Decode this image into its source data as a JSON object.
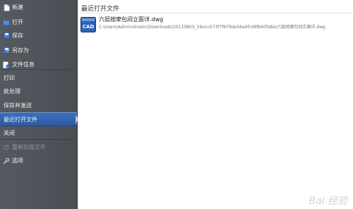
{
  "sidebar": {
    "items": [
      {
        "label": "新建",
        "icon": "new-file-icon"
      },
      {
        "label": "打开",
        "icon": "open-folder-icon"
      },
      {
        "label": "保存",
        "icon": "save-icon"
      },
      {
        "label": "另存为",
        "icon": "save-as-icon"
      },
      {
        "label": "文件信息",
        "icon": "file-info-icon"
      },
      {
        "label": "打印"
      },
      {
        "label": "批处理"
      },
      {
        "label": "保存并发送"
      },
      {
        "label": "最近打开文件"
      },
      {
        "label": "关闭"
      },
      {
        "label": "重新加载文件",
        "icon": "reload-icon"
      },
      {
        "label": "选项",
        "icon": "wrench-icon"
      }
    ]
  },
  "main": {
    "title": "最近打开文件",
    "recent_files": [
      {
        "name": "六层按摩包间立面详.dwg",
        "path": "C:\\Users\\Administrator\\Downloads\\20110803_19e1c673f7f979da56a4fcd9fb60fa8a\\六层按摩包间立面详.dwg",
        "icon_text": "CAD"
      }
    ]
  },
  "watermark": "Bai 经验",
  "colors": {
    "sidebar": "#4f5359",
    "active": "#2f63ad",
    "icon_blue": "#2b63b5"
  }
}
